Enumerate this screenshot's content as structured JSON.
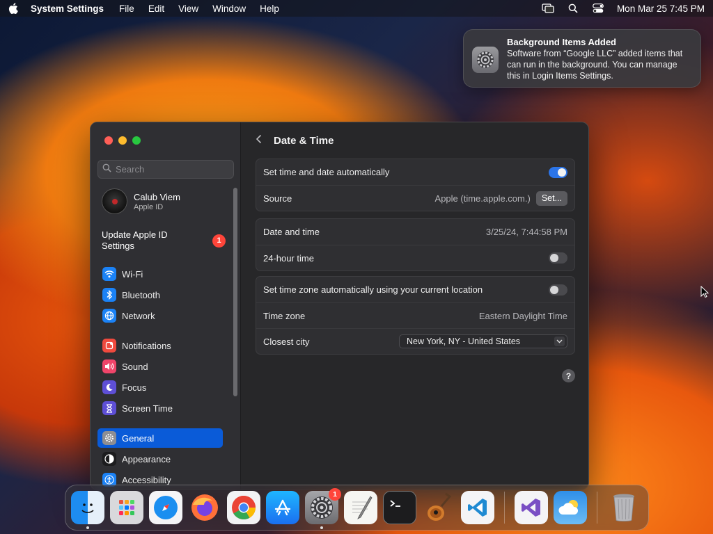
{
  "menubar": {
    "app_name": "System Settings",
    "menus": [
      "File",
      "Edit",
      "View",
      "Window",
      "Help"
    ],
    "clock": "Mon Mar 25  7:45 PM",
    "icons": [
      "apple-icon",
      "screen-mirroring-icon",
      "spotlight-search-icon",
      "control-center-icon"
    ]
  },
  "notification": {
    "title": "Background Items Added",
    "body": "Software from “Google LLC” added items that can run in the background. You can manage this in Login Items Settings.",
    "icon": "system-settings-gear-icon"
  },
  "sidebar": {
    "search_placeholder": "Search",
    "account": {
      "name": "Calub Viem",
      "subtitle": "Apple ID"
    },
    "update": {
      "label": "Update Apple ID Settings",
      "badge": "1"
    },
    "items": [
      {
        "label": "Wi-Fi",
        "icon": "wifi-icon",
        "color": "#1b82f6"
      },
      {
        "label": "Bluetooth",
        "icon": "bluetooth-icon",
        "color": "#1b82f6"
      },
      {
        "label": "Network",
        "icon": "globe-icon",
        "color": "#1b82f6"
      },
      {
        "label": "Notifications",
        "icon": "bell-icon",
        "color": "#f04a3e"
      },
      {
        "label": "Sound",
        "icon": "speaker-icon",
        "color": "#f0456a"
      },
      {
        "label": "Focus",
        "icon": "moon-icon",
        "color": "#5e4fd6"
      },
      {
        "label": "Screen Time",
        "icon": "hourglass-icon",
        "color": "#5e4fd6"
      },
      {
        "label": "General",
        "icon": "gear-icon",
        "color": "#8e8e93"
      },
      {
        "label": "Appearance",
        "icon": "appearance-icon",
        "color": "#1c1c1e"
      },
      {
        "label": "Accessibility",
        "icon": "accessibility-icon",
        "color": "#1b82f6"
      }
    ],
    "selected": "General"
  },
  "main": {
    "title": "Date & Time",
    "auto_time": {
      "label": "Set time and date automatically",
      "enabled": true
    },
    "source": {
      "label": "Source",
      "value": "Apple (time.apple.com.)",
      "button": "Set..."
    },
    "date_time": {
      "label": "Date and time",
      "value": "3/25/24, 7:44:58 PM"
    },
    "hour24": {
      "label": "24-hour time",
      "enabled": false
    },
    "auto_timezone": {
      "label": "Set time zone automatically using your current location",
      "enabled": false
    },
    "time_zone": {
      "label": "Time zone",
      "value": "Eastern Daylight Time"
    },
    "closest_city": {
      "label": "Closest city",
      "value": "New York, NY - United States"
    },
    "help": "?"
  },
  "dock": {
    "apps": [
      "Finder",
      "Launchpad",
      "Safari",
      "Firefox",
      "Chrome",
      "App Store",
      "System Settings",
      "TextEdit",
      "Terminal",
      "GarageBand",
      "Visual Studio Code",
      "Visual Studio",
      "Weather",
      "Trash"
    ],
    "system_settings_badge": "1"
  }
}
